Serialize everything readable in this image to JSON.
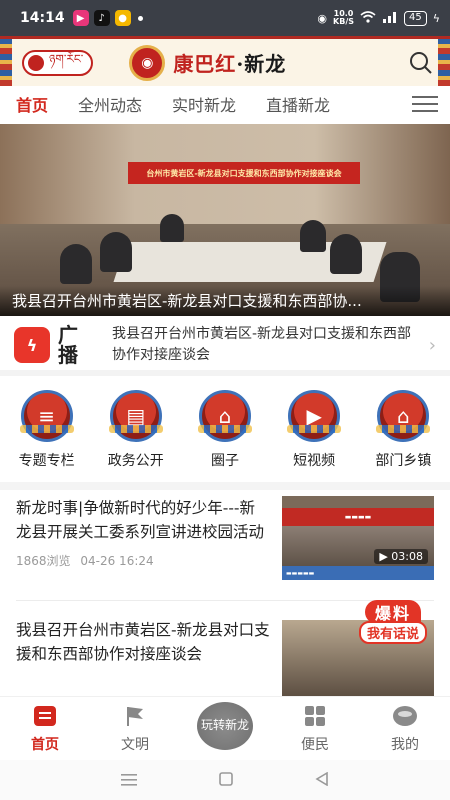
{
  "status_bar": {
    "time": "14:14",
    "net_speed_value": "10.0",
    "net_speed_unit": "KB/S",
    "battery": "45"
  },
  "header": {
    "tibetan_label": "ཉག་རོང་",
    "logo_text_red": "康巴红",
    "logo_text_sep": "·",
    "logo_text_black": "新龙"
  },
  "tabs": [
    {
      "label": "首页",
      "active": true
    },
    {
      "label": "全州动态",
      "active": false
    },
    {
      "label": "实时新龙",
      "active": false
    },
    {
      "label": "直播新龙",
      "active": false
    }
  ],
  "hero": {
    "banner_text": "台州市黄岩区-新龙县对口支援和东西部协作对接座谈会",
    "caption": "我县召开台州市黄岩区-新龙县对口支援和东西部协..."
  },
  "broadcast": {
    "label": "广播",
    "text": "我县召开台州市黄岩区-新龙县对口支援和东西部协作对接座谈会"
  },
  "grid": [
    {
      "label": "专题专栏",
      "icon": "≡"
    },
    {
      "label": "政务公开",
      "icon": "▤"
    },
    {
      "label": "圈子",
      "icon": "⌂"
    },
    {
      "label": "短视频",
      "icon": "▶"
    },
    {
      "label": "部门乡镇",
      "icon": "⌂"
    }
  ],
  "news": [
    {
      "title": "新龙时事|争做新时代的好少年---新龙县开展关工委系列宣讲进校园活动",
      "views": "1868浏览",
      "date": "04-26 16:24",
      "duration": "03:08"
    },
    {
      "title": "我县召开台州市黄岩区-新龙县对口支援和东西部协作对接座谈会"
    }
  ],
  "baoliao": {
    "line1": "爆料",
    "line2": "我有话说"
  },
  "bottom_nav": [
    {
      "label": "首页",
      "icon": "home-icon",
      "active": true
    },
    {
      "label": "文明",
      "icon": "flag-icon",
      "active": false
    },
    {
      "label": "玩转新龙",
      "icon": "center-icon",
      "active": false
    },
    {
      "label": "便民",
      "icon": "grid-icon",
      "active": false
    },
    {
      "label": "我的",
      "icon": "user-icon",
      "active": false
    }
  ],
  "colors": {
    "brand_red": "#d2281e",
    "status_bar": "#3b3f47"
  }
}
